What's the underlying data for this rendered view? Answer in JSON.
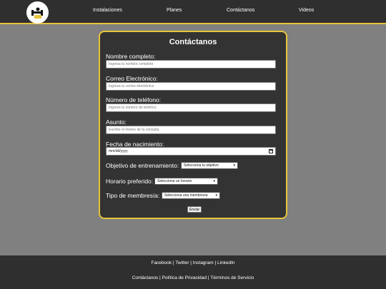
{
  "colors": {
    "accent": "#e7c43b",
    "header_bg": "#2f2f2f",
    "card_bg": "#333333",
    "page_bg": "#808080"
  },
  "header": {
    "logo_icon": "gym-logo-icon",
    "nav": [
      "Instalaciones",
      "Planes",
      "Contáctanos",
      "Videos"
    ]
  },
  "form": {
    "title": "Contáctanos",
    "name_label": "Nombre completo:",
    "name_placeholder": "Ingresa tu nombre completo",
    "email_label": "Correo Electrónico:",
    "email_placeholder": "Ingresa tu correo electrónico",
    "phone_label": "Número de teléfono:",
    "phone_placeholder": "Ingresa tu número de teléfono",
    "subject_label": "Asunto:",
    "subject_placeholder": "Escribe el motivo de tu consulta",
    "birth_label": "Fecha de nacimiento:",
    "birth_value": "mm/dd/yyyy",
    "goal_label": "Objetivo de entrenamiento:",
    "goal_selected": "Selecciona tu objetivo",
    "schedule_label": "Horario preferido:",
    "schedule_selected": "Selecciona un horario",
    "membership_label": "Tipo de membresía:",
    "membership_selected": "Selecciona una membresía",
    "submit_label": "Enviar"
  },
  "footer": {
    "social": [
      "Facebook",
      "Twitter",
      "Instagram",
      "LinkedIn"
    ],
    "legal": [
      "Contáctanos",
      "Política de Privacidad",
      "Términos de Servicio"
    ],
    "separator": "|"
  }
}
